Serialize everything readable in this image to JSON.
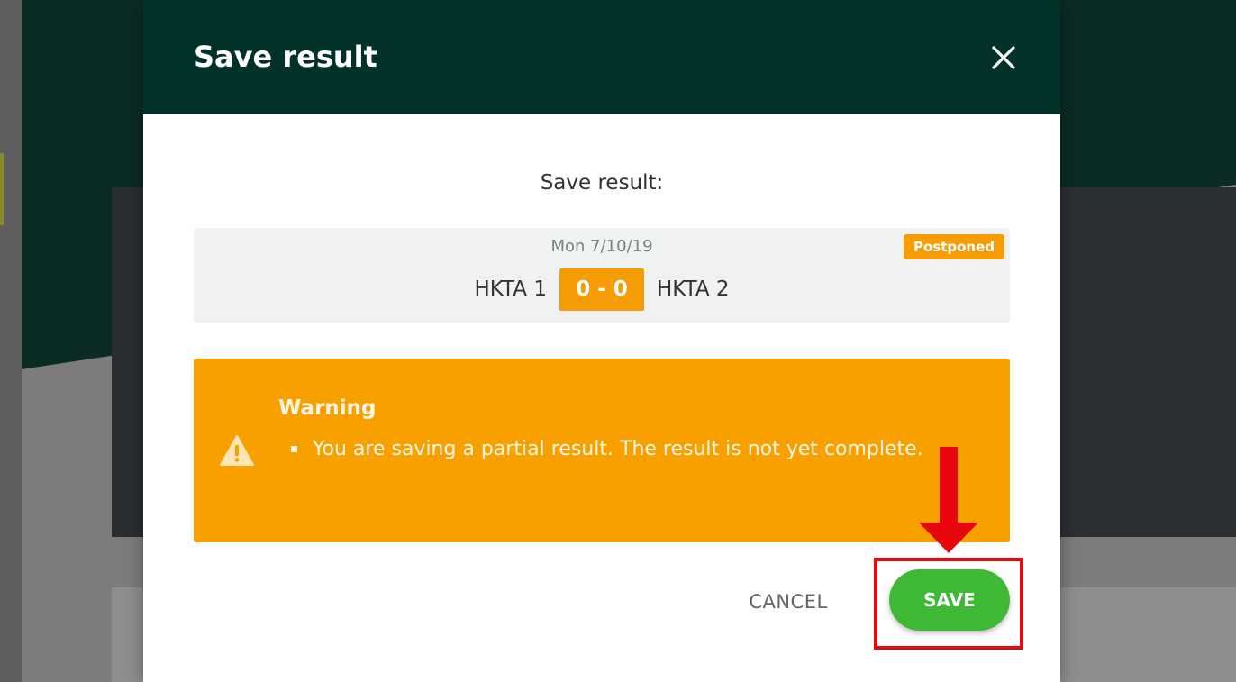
{
  "modal": {
    "title": "Save result",
    "close_icon": "close-icon",
    "prompt": "Save result:",
    "match": {
      "date": "Mon 7/10/19",
      "status_badge": "Postponed",
      "home_team": "HKTA 1",
      "score": "0 - 0",
      "away_team": "HKTA 2"
    },
    "warning": {
      "icon": "warning-triangle-icon",
      "title": "Warning",
      "messages": [
        "You are saving a partial result. The result is not yet complete."
      ]
    },
    "actions": {
      "cancel_label": "CANCEL",
      "save_label": "SAVE"
    }
  },
  "colors": {
    "header_bg": "#02312a",
    "badge_orange": "#f69d06",
    "warning_bg": "#f9a001",
    "save_green": "#3eb835",
    "annotation_red": "#e8070d"
  },
  "annotation": {
    "arrow_icon": "red-down-arrow-icon",
    "target": "save-button"
  }
}
